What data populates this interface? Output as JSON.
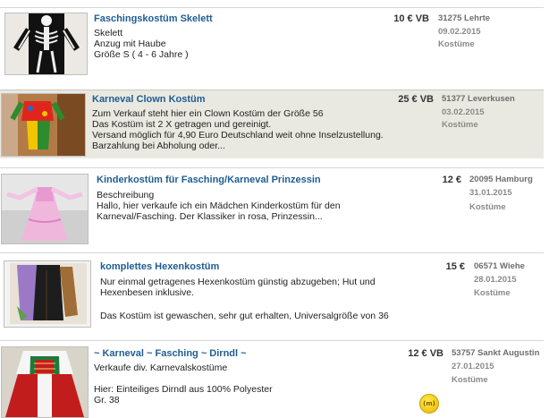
{
  "listings": [
    {
      "title": "Faschingskostüm Skelett",
      "description": [
        "Skelett",
        "Anzug mit Haube",
        "Größe S ( 4 - 6 Jahre )"
      ],
      "price": "10 € VB",
      "location": "31275 Lehrte",
      "date": "09.02.2015",
      "category": "Kostüme",
      "image": "skeleton-costume-photo"
    },
    {
      "title": "Karneval Clown Kostüm",
      "description": [
        "Zum Verkauf steht hier ein Clown Kostüm der Größe 56",
        "Das Kostüm ist 2 X getragen und gereinigt.",
        "Versand möglich für 4,90 Euro Deutschland weit ohne Inselzustellung.",
        "Barzahlung bei Abholung oder..."
      ],
      "price": "25 € VB",
      "location": "51377 Leverkusen",
      "date": "03.02.2015",
      "category": "Kostüme",
      "image": "clown-costume-photo"
    },
    {
      "title": "Kinderkostüm für Fasching/Karneval Prinzessin",
      "description": [
        "Beschreibung",
        "Hallo, hier verkaufe ich ein Mädchen Kinderkostüm für den",
        "Karneval/Fasching. Der Klassiker in rosa, Prinzessin..."
      ],
      "price": "12 €",
      "location": "20095 Hamburg",
      "date": "31.01.2015",
      "category": "Kostüme",
      "image": "princess-costume-photo"
    },
    {
      "title": "komplettes Hexenkostüm",
      "description": [
        "Nur einmal getragenes Hexenkostüm günstig abzugeben; Hut und",
        "Hexenbesen inklusive.",
        "",
        "Das Kostüm ist gewaschen, sehr gut erhalten, Universalgröße von 36"
      ],
      "price": "15 €",
      "location": "06571 Wiehe",
      "date": "28.01.2015",
      "category": "Kostüme",
      "image": "witch-costume-photo"
    },
    {
      "title": "~ Karneval ~ Fasching ~ Dirndl ~",
      "description": [
        "Verkaufe div. Karnevalskostüme",
        "",
        "Hier: Einteiliges Dirndl aus 100% Polyester",
        "Gr. 38"
      ],
      "price": "12 € VB",
      "location": "53757 Sankt Augustin",
      "date": "27.01.2015",
      "category": "Kostüme",
      "image": "dirndl-costume-photo",
      "badge": "(m)"
    }
  ]
}
